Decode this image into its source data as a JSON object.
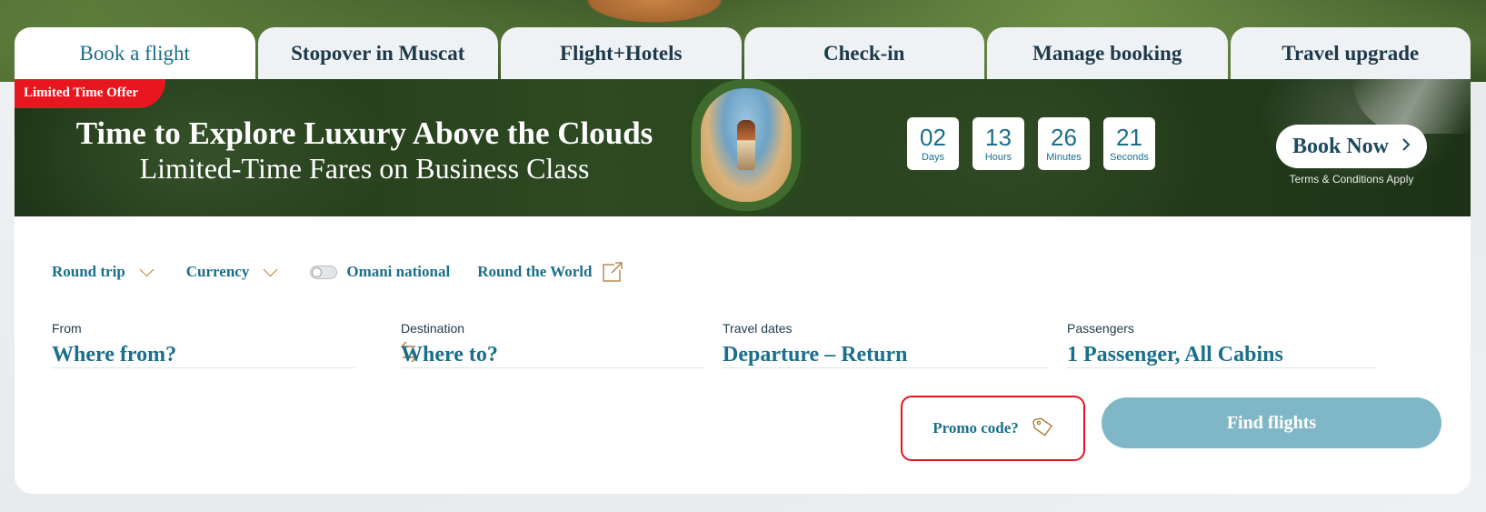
{
  "tabs": [
    {
      "label": "Book a flight",
      "active": true
    },
    {
      "label": "Stopover in Muscat",
      "active": false
    },
    {
      "label": "Flight+Hotels",
      "active": false
    },
    {
      "label": "Check-in",
      "active": false
    },
    {
      "label": "Manage booking",
      "active": false
    },
    {
      "label": "Travel upgrade",
      "active": false
    }
  ],
  "banner": {
    "badge": "Limited Time Offer",
    "title": "Time to Explore Luxury Above the Clouds",
    "subtitle": "Limited-Time Fares on Business Class",
    "countdown": [
      {
        "value": "02",
        "unit": "Days"
      },
      {
        "value": "13",
        "unit": "Hours"
      },
      {
        "value": "26",
        "unit": "Minutes"
      },
      {
        "value": "21",
        "unit": "Seconds"
      }
    ],
    "cta_label": "Book Now",
    "cta_icon": "chevron-right-icon",
    "terms": "Terms & Conditions Apply",
    "badge_color": "#e8171f"
  },
  "options": {
    "trip_type": "Round trip",
    "currency": "Currency",
    "omani_national": "Omani national",
    "omani_national_on": false,
    "round_the_world": "Round the World"
  },
  "fields": {
    "from": {
      "label": "From",
      "value": "Where from?"
    },
    "destination": {
      "label": "Destination",
      "value": "Where to?"
    },
    "dates": {
      "label": "Travel dates",
      "value": "Departure – Return"
    },
    "passengers": {
      "label": "Passengers",
      "value": "1 Passenger, All Cabins"
    }
  },
  "promo": {
    "label": "Promo code?",
    "icon": "tag-icon"
  },
  "search": {
    "label": "Find flights"
  },
  "colors": {
    "accent": "#1a6f8a",
    "gold": "#b07a3a",
    "find_button": "#7fb7c7",
    "highlight_border": "#e3121d"
  }
}
